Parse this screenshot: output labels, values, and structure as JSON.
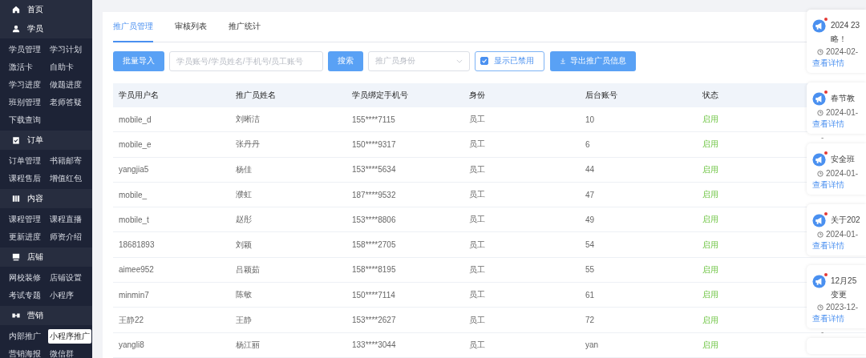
{
  "sidebar": [
    {
      "label": "首页"
    },
    {
      "label": "学员",
      "items": [
        {
          "label": "学员管理",
          "selected": false
        },
        {
          "label": "学习计划",
          "selected": false
        },
        {
          "label": "激活卡",
          "selected": false
        },
        {
          "label": "自助卡",
          "selected": false
        },
        {
          "label": "学习进度",
          "selected": false
        },
        {
          "label": "做题进度",
          "selected": false
        },
        {
          "label": "班别管理",
          "selected": false
        },
        {
          "label": "老师答疑",
          "selected": false
        },
        {
          "label": "下载查询",
          "selected": false
        }
      ]
    },
    {
      "label": "订单",
      "items": [
        {
          "label": "订单管理",
          "selected": false
        },
        {
          "label": "书籍邮寄",
          "selected": false
        },
        {
          "label": "课程售后",
          "selected": false
        },
        {
          "label": "增值红包",
          "selected": false
        }
      ]
    },
    {
      "label": "内容",
      "items": [
        {
          "label": "课程管理",
          "selected": false
        },
        {
          "label": "课程直播",
          "selected": false
        },
        {
          "label": "更新进度",
          "selected": false
        },
        {
          "label": "师资介绍",
          "selected": false
        }
      ]
    },
    {
      "label": "店铺",
      "items": [
        {
          "label": "网校装修",
          "selected": false
        },
        {
          "label": "店铺设置",
          "selected": false
        },
        {
          "label": "考试专题",
          "selected": false
        },
        {
          "label": "小程序",
          "selected": false
        }
      ]
    },
    {
      "label": "营销",
      "items": [
        {
          "label": "内部推广",
          "selected": false
        },
        {
          "label": "小程序推广",
          "selected": true
        },
        {
          "label": "营销海报",
          "selected": false
        },
        {
          "label": "微信群",
          "selected": false
        }
      ]
    }
  ],
  "tabs": [
    {
      "label": "推广员管理",
      "selected": true
    },
    {
      "label": "审核列表",
      "selected": false
    },
    {
      "label": "推广统计",
      "selected": false
    }
  ],
  "toolbar": {
    "import_button": "批量导入",
    "search": {
      "placeholder": "学员账号/学员姓名/手机号/员工账号"
    },
    "search_button": "搜索",
    "role_select": {
      "placeholder": "推广员身份"
    },
    "show_disabled": {
      "label": "显示已禁用",
      "checked": true
    },
    "export_button": "导出推广员信息"
  },
  "table": {
    "columns": [
      "学员用户名",
      "推广员姓名",
      "学员绑定手机号",
      "身份",
      "后台账号",
      "状态"
    ],
    "rows": [
      [
        "mobile_d",
        "刘晰洁",
        "155****7115",
        "员工",
        "10",
        "启用"
      ],
      [
        "mobile_e",
        "张丹丹",
        "150****9317",
        "员工",
        "6",
        "启用"
      ],
      [
        "yangjia5",
        "杨佳",
        "153****5634",
        "员工",
        "44",
        "启用"
      ],
      [
        "mobile_",
        "濮虹",
        "187****9532",
        "员工",
        "47",
        "启用"
      ],
      [
        "mobile_t",
        "赵彤",
        "153****8806",
        "员工",
        "49",
        "启用"
      ],
      [
        "18681893",
        "刘颖",
        "158****2705",
        "员工",
        "54",
        "启用"
      ],
      [
        "aimee952",
        "吕颖茹",
        "158****8195",
        "员工",
        "55",
        "启用"
      ],
      [
        "minmin7",
        "陈敏",
        "150****7114",
        "员工",
        "61",
        "启用"
      ],
      [
        "王静22",
        "王静",
        "153****2627",
        "员工",
        "72",
        "启用"
      ],
      [
        "yangli8",
        "杨江丽",
        "133****3044",
        "员工",
        "yan",
        "启用"
      ]
    ]
  },
  "notifications": [
    {
      "title": "2024 23",
      "title_line2": "略！",
      "date": "2024-02-",
      "link": "查看详情",
      "unread": true
    },
    {
      "title": "春节教",
      "date": "2024-01-",
      "link": "查看详情",
      "unread": true,
      "after": "-"
    },
    {
      "title": "安全班",
      "date": "2024-01-",
      "link": "查看详情",
      "unread": true
    },
    {
      "title": "关于202",
      "date": "2024-01-",
      "link": "查看详情",
      "unread": true
    },
    {
      "title": "12月25",
      "title_line2": "变更",
      "date": "2023-12-",
      "link": "查看详情",
      "unread": true,
      "after": "-"
    }
  ]
}
